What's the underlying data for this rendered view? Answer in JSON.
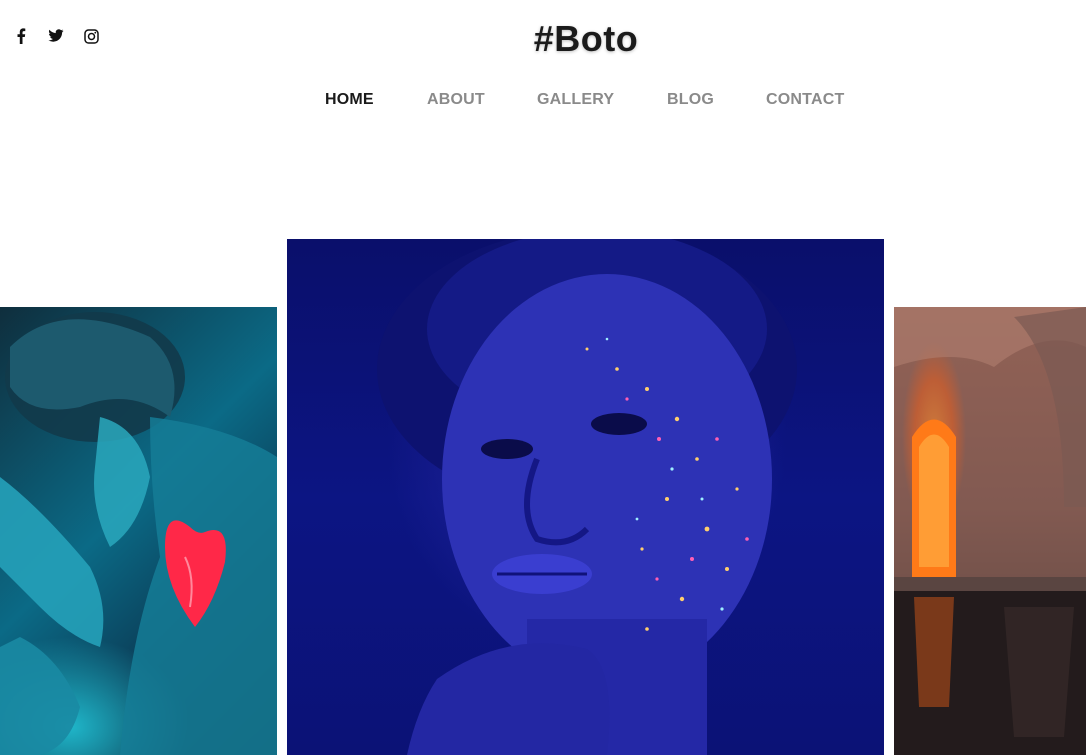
{
  "site": {
    "logo": "#Boto"
  },
  "social": [
    {
      "name": "facebook-icon"
    },
    {
      "name": "twitter-icon"
    },
    {
      "name": "instagram-icon"
    }
  ],
  "nav": {
    "items": [
      {
        "label": "HOME",
        "active": true
      },
      {
        "label": "ABOUT",
        "active": false
      },
      {
        "label": "GALLERY",
        "active": false
      },
      {
        "label": "BLOG",
        "active": false
      },
      {
        "label": "CONTACT",
        "active": false
      }
    ]
  },
  "colors": {
    "accent": "#8cc43f",
    "nav_text": "#8a8a8a",
    "nav_active": "#1a1a1a"
  },
  "gallery": {
    "images": [
      {
        "description": "man-with-glowing-heart-body-paint"
      },
      {
        "description": "woman-with-glitter-face-paint-blue-light"
      },
      {
        "description": "orange-lit-archway-in-stone-room"
      }
    ]
  }
}
